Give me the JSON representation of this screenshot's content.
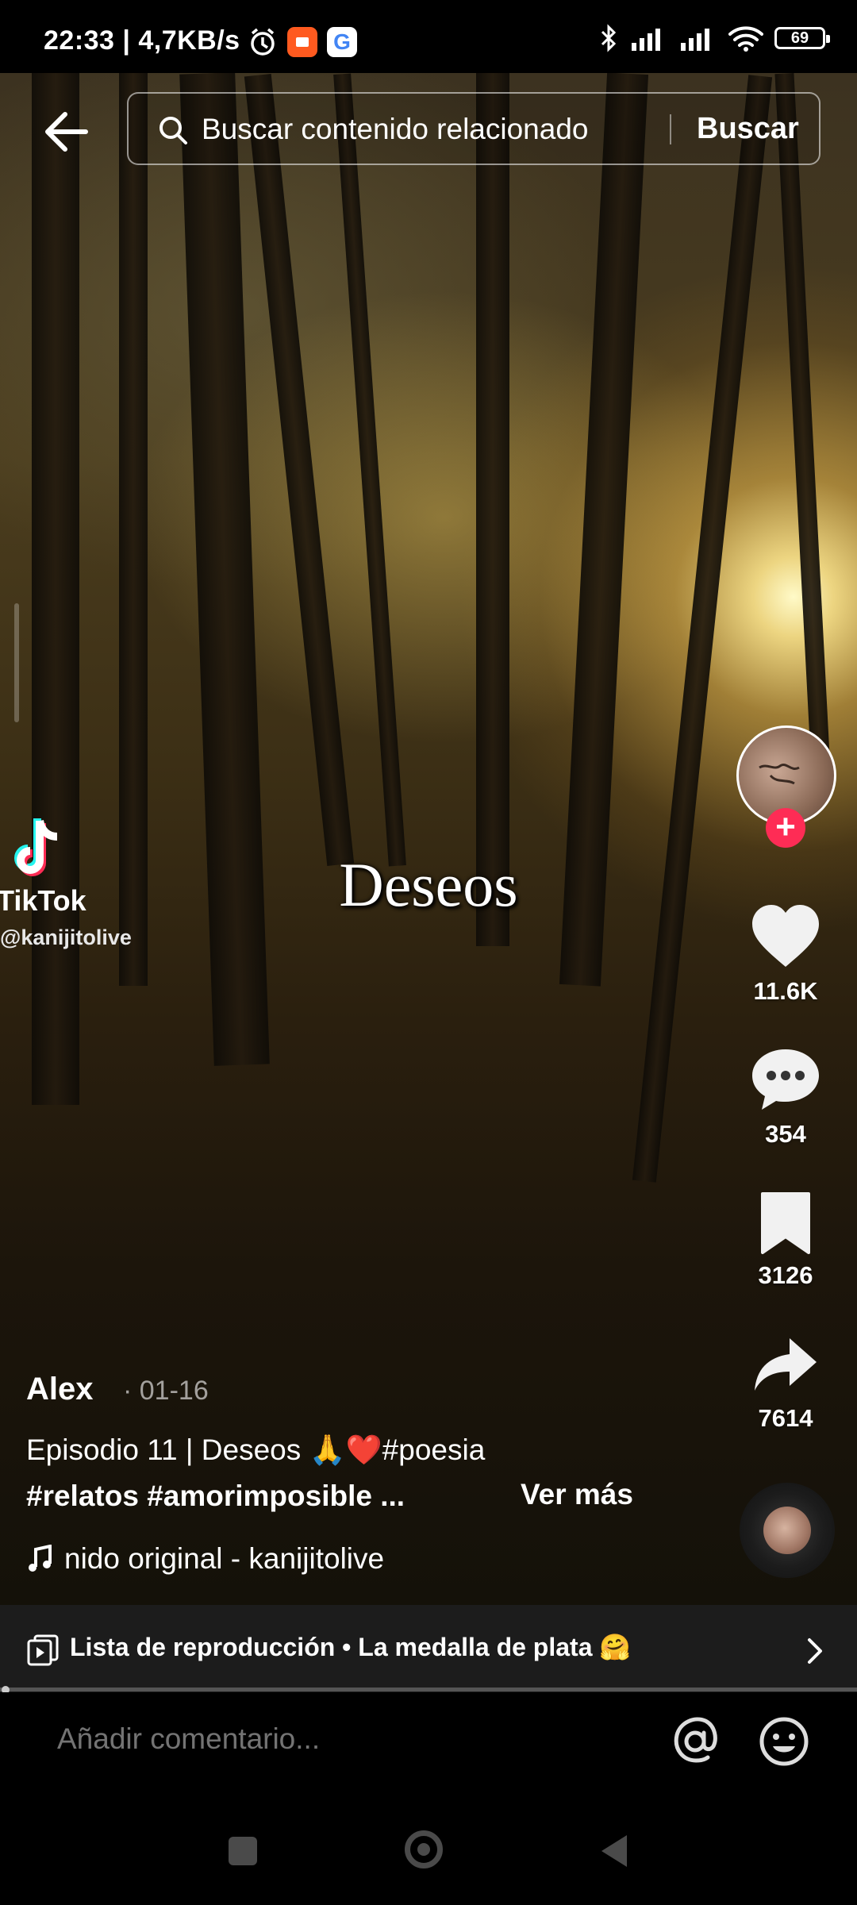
{
  "status_bar": {
    "time_speed": "22:33 | 4,7KB/s",
    "battery": "69"
  },
  "search": {
    "placeholder": "Buscar contenido relacionado",
    "button_label": "Buscar"
  },
  "video": {
    "overlay_title": "Deseos",
    "watermark_brand": "TikTok",
    "watermark_user": "@kanijitolive"
  },
  "actions": {
    "likes": "11.6K",
    "comments": "354",
    "saves": "3126",
    "shares": "7614"
  },
  "post": {
    "author": "Alex",
    "date": "· 01-16",
    "caption_line1": "Episodio 11 | Deseos 🙏❤️#poesia",
    "caption_line2": "#relatos #amorimposible ...",
    "more_label": "Ver más",
    "music": "nido original - kanijitolive"
  },
  "playlist": {
    "label": "Lista de reproducción • La medalla de plata 🤗"
  },
  "comment_bar": {
    "placeholder": "Añadir comentario..."
  },
  "colors": {
    "follow_accent": "#fe2c55",
    "playlist_bg": "#1c1c1c"
  }
}
